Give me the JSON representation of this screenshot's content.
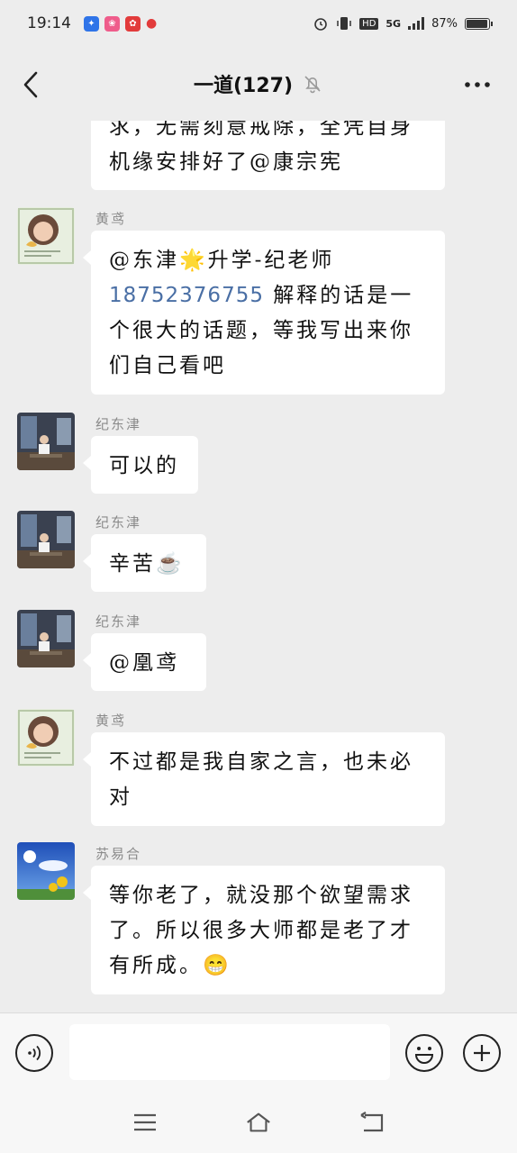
{
  "status_bar": {
    "time": "19:14",
    "network": "5G",
    "hd": "HD",
    "battery": "87%"
  },
  "header": {
    "title": "一道(127)"
  },
  "messages": [
    {
      "sender": "",
      "lines": [
        "求，无需刻意戒除，全凭自身",
        "机缘安排好了@康宗宪"
      ]
    },
    {
      "sender": "黄鸢",
      "lines": [
        "@东津🌟升学-纪老师",
        "18752376755",
        "解释的话是一",
        "个很大的话题，等我写出来你",
        "们自己看吧"
      ]
    },
    {
      "sender": "纪东津",
      "lines": [
        "可以的"
      ]
    },
    {
      "sender": "纪东津",
      "lines": [
        "辛苦☕"
      ]
    },
    {
      "sender": "纪东津",
      "lines": [
        "@凰鸢"
      ]
    },
    {
      "sender": "黄鸢",
      "lines": [
        "不过都是我自家之言，也未必",
        "对"
      ]
    },
    {
      "sender": "苏易合",
      "lines": [
        "等你老了，就没那个欲望需求",
        "了。所以很多大师都是老了才",
        "有所成。😁"
      ]
    }
  ],
  "input": {
    "placeholder": ""
  },
  "icons": {
    "back": "back-arrow-icon",
    "mute": "bell-off-icon",
    "more": "more-dots-icon",
    "voice": "voice-icon",
    "emoji": "emoji-icon",
    "plus": "plus-icon",
    "menu": "menu-icon",
    "home": "home-icon",
    "return": "return-icon"
  },
  "colors": {
    "background": "#ededed",
    "bubble": "#ffffff",
    "link": "#4a6fa5",
    "sender": "#8a8a8a"
  }
}
